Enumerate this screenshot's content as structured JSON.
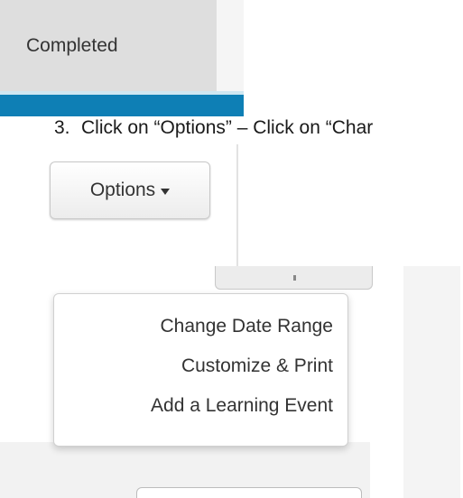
{
  "tabs": {
    "active_label": "Completed"
  },
  "instruction": {
    "number": "3.",
    "text": "Click on “Options” – Click on “Char"
  },
  "options_button": {
    "label": "Options"
  },
  "menu": {
    "items": [
      {
        "label": "Change Date Range"
      },
      {
        "label": "Customize & Print"
      },
      {
        "label": "Add a Learning Event"
      }
    ]
  },
  "colors": {
    "accent": "#0e7fb5",
    "tab_bg": "#dedede",
    "text": "#333333"
  },
  "icons": {
    "options_caret": "caret-down-icon"
  }
}
